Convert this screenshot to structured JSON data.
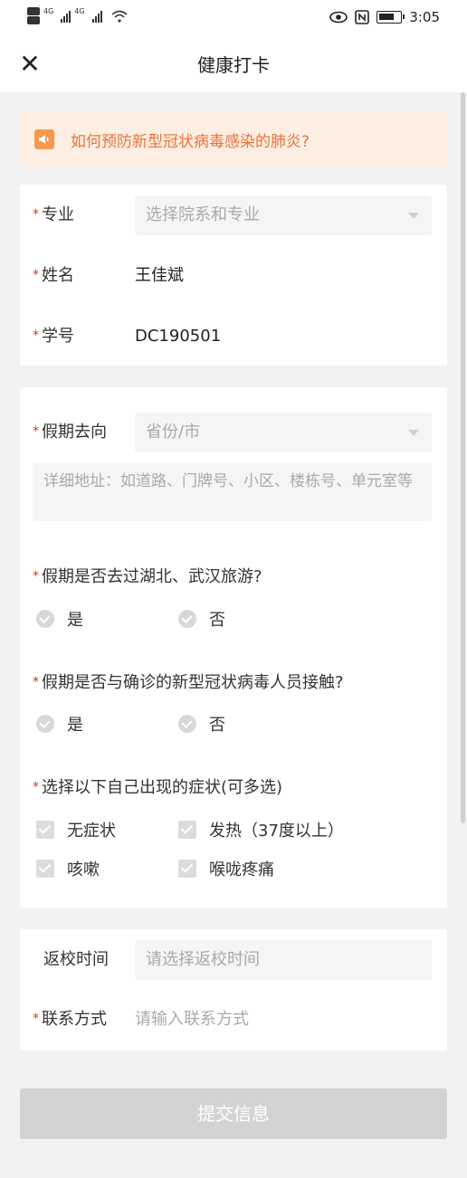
{
  "status_bar": {
    "signal_label_1": "4G",
    "signal_label_2": "4G",
    "time": "3:05",
    "icons": [
      "hd-icon",
      "signal-icon",
      "wifi-icon",
      "eye-icon",
      "nfc-icon",
      "battery-icon"
    ]
  },
  "nav": {
    "close_icon": "close-icon",
    "title": "健康打卡"
  },
  "notice": {
    "icon": "speaker-icon",
    "text": "如何预防新型冠状病毒感染的肺炎?"
  },
  "basic_info": {
    "major_label": "专业",
    "major_placeholder": "选择院系和专业",
    "name_label": "姓名",
    "name_value": "王佳斌",
    "student_id_label": "学号",
    "student_id_value": "DC190501"
  },
  "travel": {
    "destination_label": "假期去向",
    "destination_placeholder": "省份/市",
    "address_placeholder": "详细地址：如道路、门牌号、小区、楼栋号、单元室等",
    "q1": "假期是否去过湖北、武汉旅游?",
    "q1_yes": "是",
    "q1_no": "否",
    "q2": "假期是否与确诊的新型冠状病毒人员接触?",
    "q2_yes": "是",
    "q2_no": "否",
    "q3": "选择以下自己出现的症状(可多选)",
    "symptoms": [
      "无症状",
      "发热（37度以上）",
      "咳嗽",
      "喉咙疼痛"
    ]
  },
  "return": {
    "return_time_label": "返校时间",
    "return_time_placeholder": "请选择返校时间",
    "contact_label": "联系方式",
    "contact_placeholder": "请输入联系方式"
  },
  "submit_label": "提交信息",
  "required_mark": "*",
  "colors": {
    "accent_orange": "#e8743b",
    "required_red": "#e0301e",
    "banner_bg": "#fdeee3",
    "disabled_button": "#d3d3d3"
  }
}
